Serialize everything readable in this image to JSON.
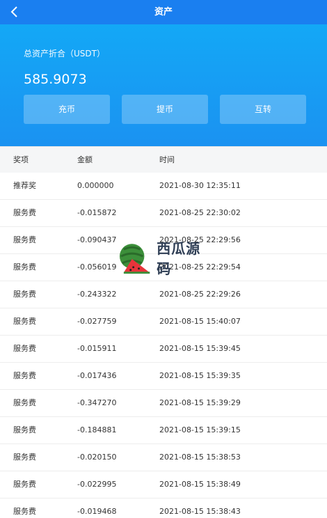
{
  "nav": {
    "title": "资产"
  },
  "asset": {
    "label": "总资产折合（USDT）",
    "value": "585.9073"
  },
  "actions": [
    {
      "label": "充币"
    },
    {
      "label": "提币"
    },
    {
      "label": "互转"
    }
  ],
  "table": {
    "headers": [
      "奖项",
      "金额",
      "时间"
    ],
    "rows": [
      {
        "type": "推荐奖",
        "amount": "0.000000",
        "time": "2021-08-30 12:35:11"
      },
      {
        "type": "服务费",
        "amount": "-0.015872",
        "time": "2021-08-25 22:30:02"
      },
      {
        "type": "服务费",
        "amount": "-0.090437",
        "time": "2021-08-25 22:29:56"
      },
      {
        "type": "服务费",
        "amount": "-0.056019",
        "time": "2021-08-25 22:29:54"
      },
      {
        "type": "服务费",
        "amount": "-0.243322",
        "time": "2021-08-25 22:29:26"
      },
      {
        "type": "服务费",
        "amount": "-0.027759",
        "time": "2021-08-15 15:40:07"
      },
      {
        "type": "服务费",
        "amount": "-0.015911",
        "time": "2021-08-15 15:39:45"
      },
      {
        "type": "服务费",
        "amount": "-0.017436",
        "time": "2021-08-15 15:39:35"
      },
      {
        "type": "服务费",
        "amount": "-0.347270",
        "time": "2021-08-15 15:39:29"
      },
      {
        "type": "服务费",
        "amount": "-0.184881",
        "time": "2021-08-15 15:39:15"
      },
      {
        "type": "服务费",
        "amount": "-0.020150",
        "time": "2021-08-15 15:38:53"
      },
      {
        "type": "服务费",
        "amount": "-0.022995",
        "time": "2021-08-15 15:38:49"
      },
      {
        "type": "服务费",
        "amount": "-0.019468",
        "time": "2021-08-15 15:38:43"
      }
    ]
  },
  "watermark": {
    "text": "西瓜源码"
  },
  "colors": {
    "navbar": "#1a7ff0",
    "hero_top": "#13a8f6",
    "hero_bottom": "#1b92f1"
  }
}
